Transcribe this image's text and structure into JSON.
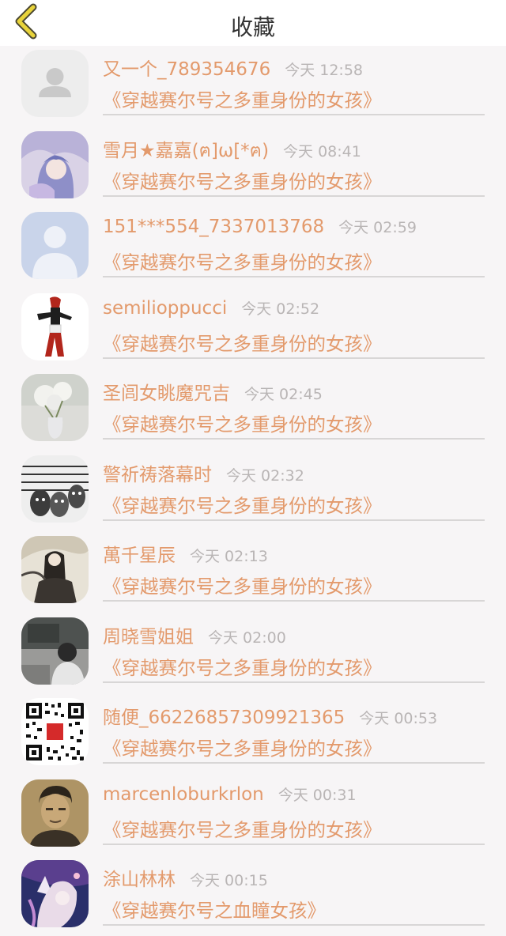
{
  "header": {
    "title": "收藏",
    "back_icon": "chevron-left-icon",
    "accent": "#e8d33a"
  },
  "items": [
    {
      "name": "又一个_789354676",
      "time": "今天 12:58",
      "book": "《穿越赛尔号之多重身份的女孩》",
      "avatar": "default-avatar-gray"
    },
    {
      "name": "雪月★嘉嘉(ฅ]ω[*ฅ)",
      "time": "今天 08:41",
      "book": "《穿越赛尔号之多重身份的女孩》",
      "avatar": "anime-girl-avatar"
    },
    {
      "name": "151***554_7337013768",
      "time": "今天 02:59",
      "book": "《穿越赛尔号之多重身份的女孩》",
      "avatar": "default-avatar-blue"
    },
    {
      "name": "semilioppucci",
      "time": "今天 02:52",
      "book": "《穿越赛尔号之多重身份的女孩》",
      "avatar": "fighter-character-avatar"
    },
    {
      "name": "圣闾女眺魔咒吉",
      "time": "今天 02:45",
      "book": "《穿越赛尔号之多重身份的女孩》",
      "avatar": "flower-vase-avatar"
    },
    {
      "name": "警祈祷落幕时",
      "time": "今天 02:32",
      "book": "《穿越赛尔号之多重身份的女孩》",
      "avatar": "egg-faces-avatar"
    },
    {
      "name": "萬千星辰",
      "time": "今天 02:13",
      "book": "《穿越赛尔号之多重身份的女孩》",
      "avatar": "ink-painting-avatar"
    },
    {
      "name": "周晓雪姐姐",
      "time": "今天 02:00",
      "book": "《穿越赛尔号之多重身份的女孩》",
      "avatar": "classroom-photo-avatar"
    },
    {
      "name": "随便_66226857309921365",
      "time": "今天 00:53",
      "book": "《穿越赛尔号之多重身份的女孩》",
      "avatar": "qr-code-avatar"
    },
    {
      "name": "marcenloburkrlon",
      "time": "今天 00:31",
      "book": "《穿越赛尔号之多重身份的女孩》",
      "avatar": "man-portrait-avatar"
    },
    {
      "name": "涂山林林",
      "time": "今天 00:15",
      "book": "《穿越赛尔号之血瞳女孩》",
      "avatar": "fantasy-fox-avatar"
    }
  ]
}
